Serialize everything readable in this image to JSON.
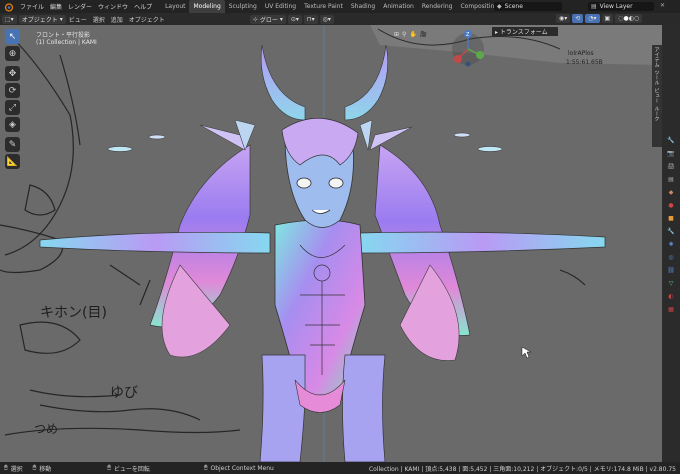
{
  "topbar": {
    "menus": [
      "ファイル",
      "編集",
      "レンダー",
      "ウィンドウ",
      "ヘルプ"
    ],
    "workspaces": [
      "Layout",
      "Modeling",
      "Sculpting",
      "UV Editing",
      "Texture Paint",
      "Shading",
      "Animation",
      "Rendering",
      "Compositing",
      "Scripting"
    ],
    "active_workspace": "Modeling",
    "scene_label": "Scene",
    "view_layer_label": "View Layer"
  },
  "header": {
    "mode": "オブジェクト",
    "menus": [
      "ビュー",
      "選択",
      "追加",
      "オブジェクト"
    ],
    "transform_orientation": "グロー"
  },
  "viewport": {
    "view_name": "フロント・平行投影",
    "collection_info": "(1) Collection | KAMI",
    "npanel_tab": "トランスフォーム",
    "sidebar_tabs": [
      "アイテム",
      "ツール",
      "ビュー",
      "ルーク"
    ]
  },
  "gizmo": {
    "z_label": "Z",
    "x_label": "X",
    "y_label": "Y"
  },
  "sketch": {
    "note_top_right": [
      "lolrAPlos",
      "1:55:61.65B"
    ],
    "kihon_text": "キホン(目)",
    "yubi_text": "ゆび",
    "tsume_text": "つめ"
  },
  "statusbar": {
    "left_select": "選択",
    "left_move": "移動",
    "rotate_view": "ビューを回転",
    "context_menu": "Object Context Menu",
    "stats": "Collection | KAMI | 頂点:5,438 | 面:5,452 | 三角面:10,212 | オブジェクト:0/5 | メモリ:174.8 MiB | v2.80.75"
  },
  "colors": {
    "accent": "#4772b3",
    "viewport_bg": "#6a6a6a",
    "ui_dark": "#232323",
    "active_orange": "#e89b3c"
  }
}
